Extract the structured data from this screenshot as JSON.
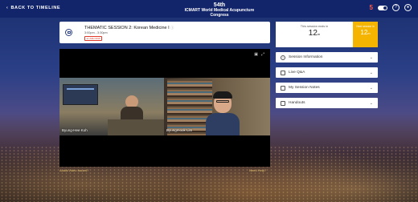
{
  "header": {
    "back_label": "BACK TO TIMELINE",
    "logo_line1": "54th",
    "logo_line2": "ICMART World Medical Acupuncture Congress",
    "notif_count": "5"
  },
  "session": {
    "title": "THEMATIC SESSION 2: Korean Medicine I",
    "time": "3:00pm - 3:30pm",
    "status": "● LIVE NOW"
  },
  "video": {
    "speaker1": "Byung-Hee Koh",
    "speaker2": "Byungmook Lim",
    "left_caption": "Audio/Video issues?",
    "right_caption": "Need Help?"
  },
  "timer": {
    "ends_label": "This session ends in",
    "ends_value": "12",
    "ends_unit": "m",
    "next_label": "Next session in",
    "next_value": "12",
    "next_unit": "m"
  },
  "panels": [
    {
      "label": "Session Information",
      "icon": "info-icon"
    },
    {
      "label": "Live Q&A",
      "icon": "chat-icon"
    },
    {
      "label": "My Session Notes",
      "icon": "notes-icon"
    },
    {
      "label": "Handouts",
      "icon": "document-icon"
    }
  ]
}
